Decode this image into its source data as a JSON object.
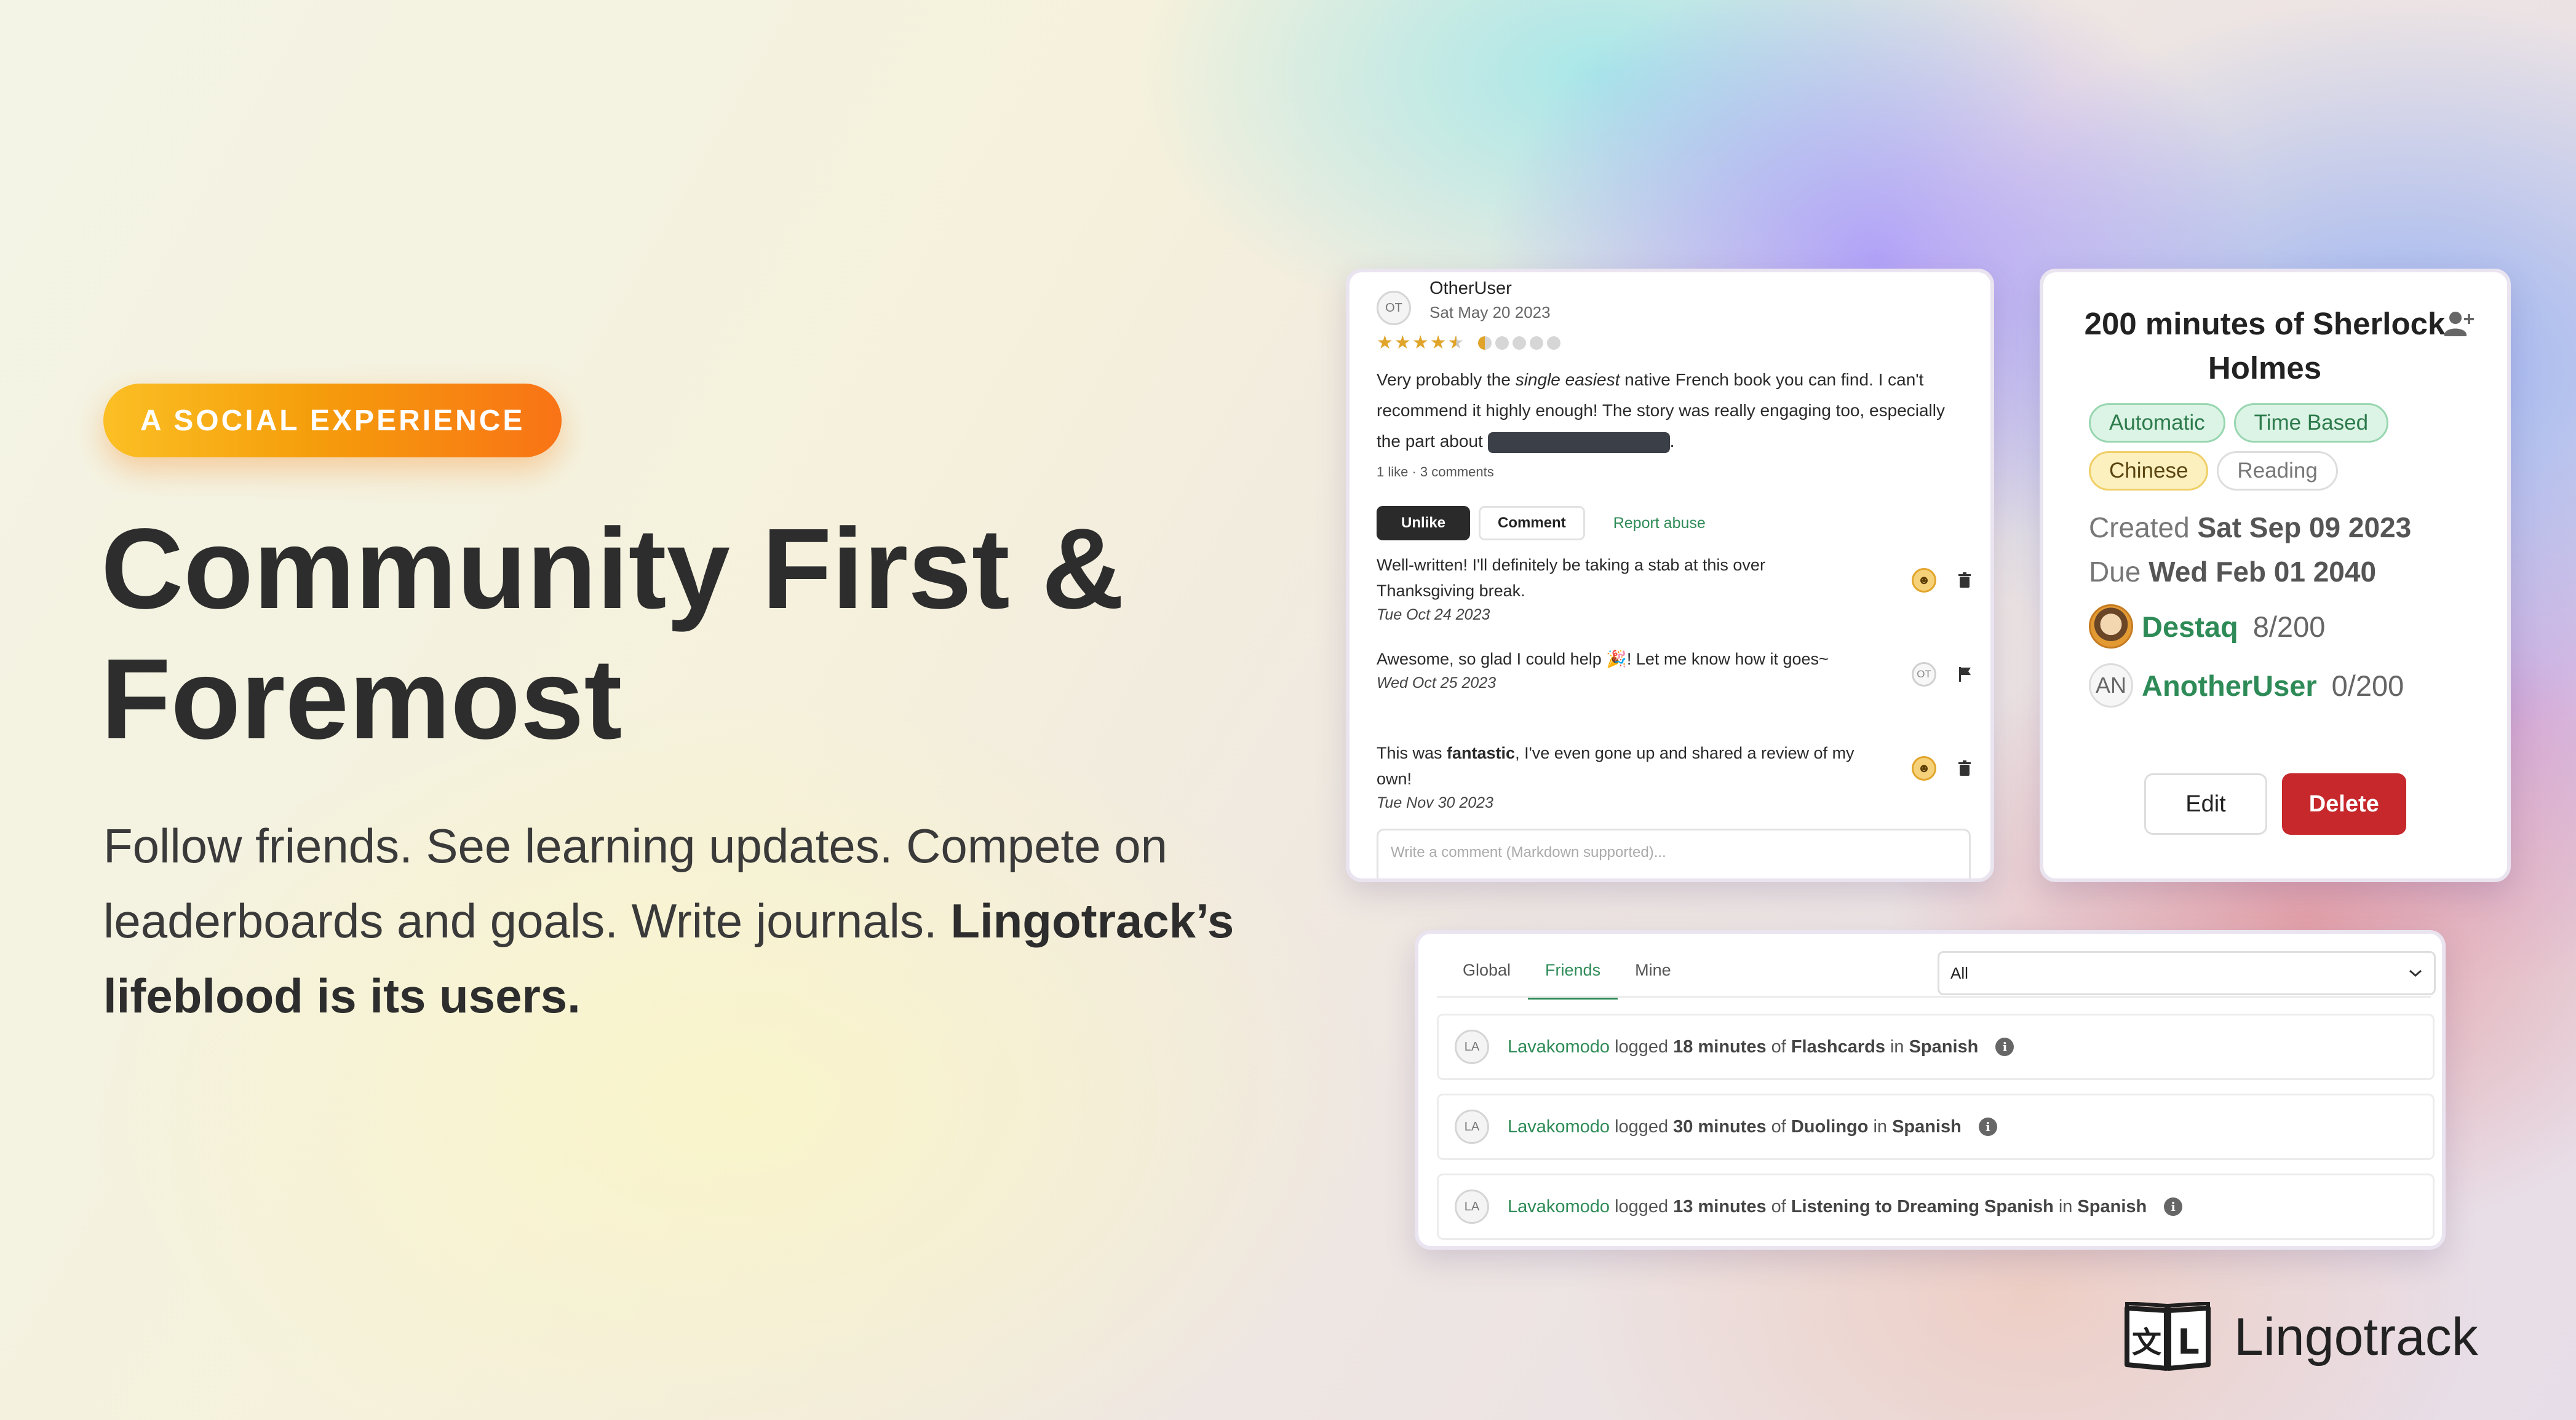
{
  "hero": {
    "badge": "A SOCIAL EXPERIENCE",
    "headline_line1": "Community First &",
    "headline_line2": "Foremost",
    "subtext_plain": "Follow friends. See learning updates. Compete on leaderboards and goals. Write journals.",
    "subtext_bold": "Lingotrack’s lifeblood is its users."
  },
  "review": {
    "avatar_initials": "OT",
    "username": "OtherUser",
    "date": "Sat May 20 2023",
    "rating_stars": 4.5,
    "rating_dots": 5,
    "rating_dot_half": 1,
    "text_before": "Very probably the ",
    "text_italic": "single easiest",
    "text_after": " native French book you can find. I can't recommend it highly enough! The story was really engaging too, especially the part about ",
    "text_end": ".",
    "meta": "1 like · 3 comments",
    "unlike_label": "Unlike",
    "comment_label": "Comment",
    "report_label": "Report abuse",
    "comments": [
      {
        "text": "Well-written! I'll definitely be taking a stab at this over Thanksgiving break.",
        "date": "Tue Oct 24 2023",
        "icon": "trash-icon"
      },
      {
        "text": "Awesome, so glad I could help 🎉! Let me know how it goes~",
        "date": "Wed Oct 25 2023",
        "avatar": "OT",
        "icon": "flag-icon"
      },
      {
        "text_before": "This was ",
        "text_bold": "fantastic",
        "text_after": ", I've even gone up and shared a review of my own!",
        "date": "Tue Nov 30 2023",
        "icon": "trash-icon"
      }
    ],
    "comment_placeholder": "Write a comment (Markdown supported)..."
  },
  "goal": {
    "title": "200 minutes of Sherlock Holmes",
    "chips": [
      {
        "label": "Automatic",
        "color": "green"
      },
      {
        "label": "Time Based",
        "color": "green"
      },
      {
        "label": "Chinese",
        "color": "yellow"
      },
      {
        "label": "Reading",
        "color": "gray"
      }
    ],
    "created_label": "Created",
    "created_date": "Sat Sep 09 2023",
    "due_label": "Due",
    "due_date": "Wed Feb 01 2040",
    "participants": [
      {
        "name": "Destaq",
        "progress": "8/200",
        "avatar": "image"
      },
      {
        "name": "AnotherUser",
        "progress": "0/200",
        "avatar": "AN"
      }
    ],
    "edit_label": "Edit",
    "delete_label": "Delete"
  },
  "feed": {
    "tabs": [
      "Global",
      "Friends",
      "Mine"
    ],
    "active_tab": "Friends",
    "filter_value": "All",
    "entries": [
      {
        "avatar": "LA",
        "user": "Lavakomodo",
        "minutes": "18 minutes",
        "activity": "Flashcards",
        "language": "Spanish"
      },
      {
        "avatar": "LA",
        "user": "Lavakomodo",
        "minutes": "30 minutes",
        "activity": "Duolingo",
        "language": "Spanish"
      },
      {
        "avatar": "LA",
        "user": "Lavakomodo",
        "minutes": "13 minutes",
        "activity": "Listening to Dreaming Spanish",
        "language": "Spanish"
      }
    ],
    "logged_word": "logged",
    "of_word": "of",
    "in_word": "in"
  },
  "brand": {
    "name": "Lingotrack",
    "accent_green": "#2e8b57",
    "badge_orange": "#f97316",
    "delete_red": "#c6282c"
  }
}
